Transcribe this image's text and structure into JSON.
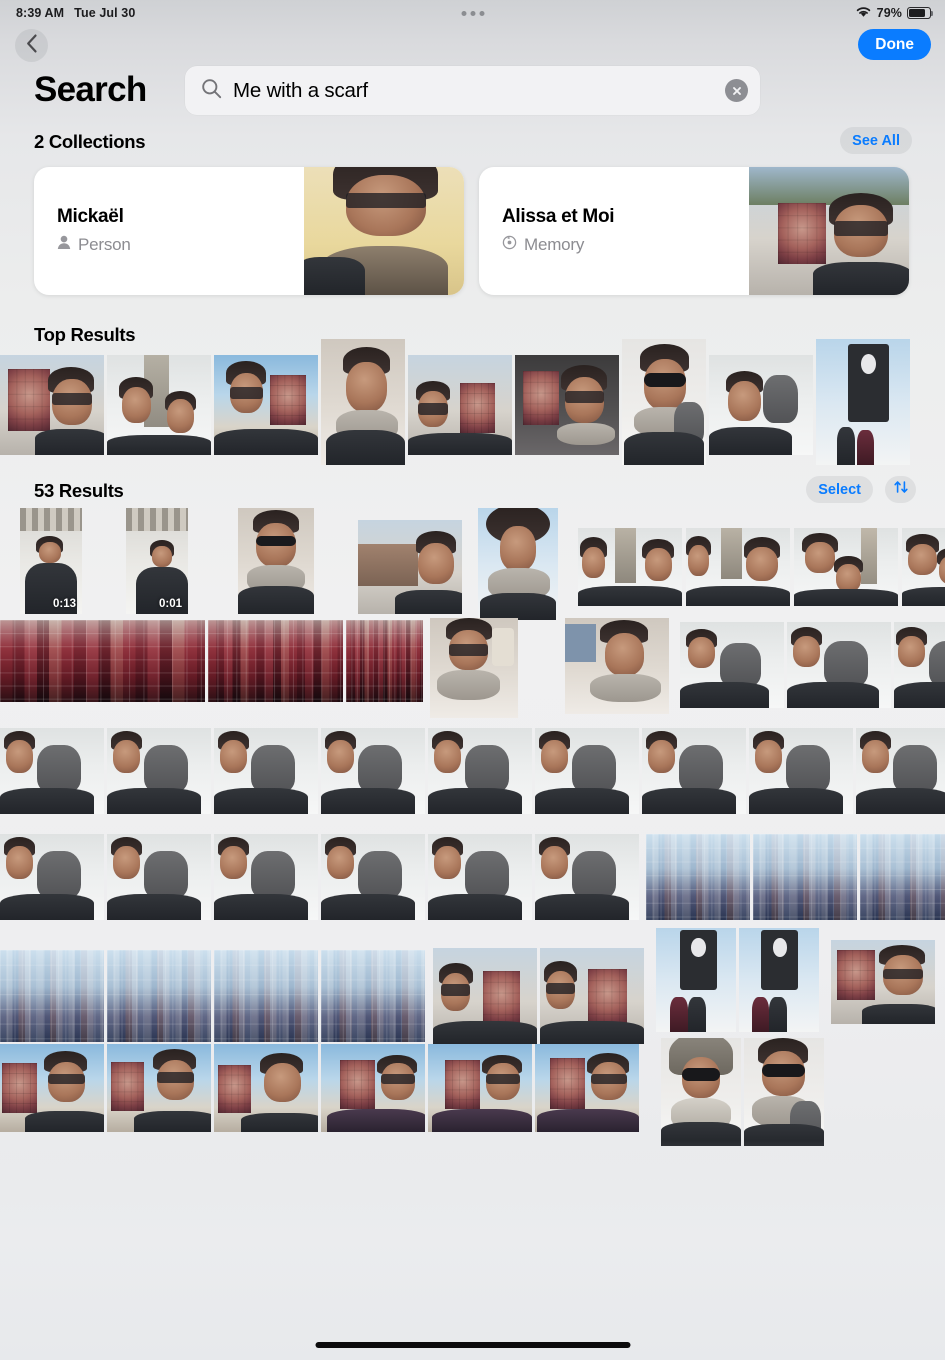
{
  "status_bar": {
    "time": "8:39 AM",
    "date": "Tue Jul 30",
    "battery_percent": "79%",
    "wifi_icon": "wifi-icon",
    "battery_icon": "battery-icon",
    "multitask_icon": "multitasking-dots-icon"
  },
  "nav": {
    "back_icon": "chevron-left-icon",
    "done_label": "Done"
  },
  "search": {
    "title": "Search",
    "value": "Me with a scarf",
    "placeholder": "Search",
    "search_icon": "search-icon",
    "clear_icon": "clear-circle-icon"
  },
  "collections_section": {
    "title": "2 Collections",
    "see_all_label": "See All",
    "items": [
      {
        "name": "Mickaël",
        "subtitle": "Person",
        "icon": "person-icon"
      },
      {
        "name": "Alissa et Moi",
        "subtitle": "Memory",
        "icon": "memory-clock-icon"
      }
    ]
  },
  "top_results_section": {
    "title": "Top Results"
  },
  "results_section": {
    "title": "53 Results",
    "select_label": "Select",
    "sort_icon": "sort-arrows-icon"
  },
  "media": {
    "durations": [
      "0:13",
      "0:01"
    ]
  },
  "colors": {
    "accent": "#0a7cff",
    "done_button": "#0a7cff",
    "pill_background": "#e3e4e7",
    "card_background": "#ffffff",
    "page_background": "#eceded",
    "title_text": "#000000",
    "subtitle_text": "#8c8c91"
  },
  "home_indicator": "home-indicator"
}
